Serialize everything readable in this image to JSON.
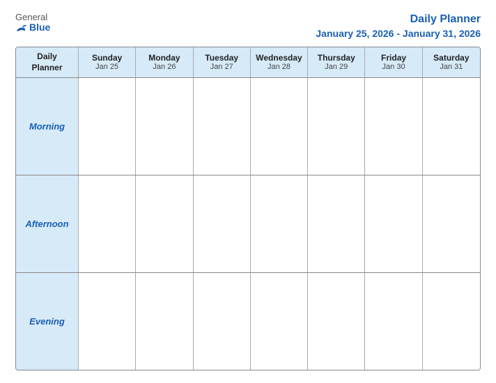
{
  "header": {
    "logo_general": "General",
    "logo_blue": "Blue",
    "title_line1": "Daily Planner",
    "title_line2": "January 25, 2026 - January 31, 2026"
  },
  "calendar": {
    "header": {
      "col0_line1": "Daily",
      "col0_line2": "Planner",
      "days": [
        {
          "name": "Sunday",
          "date": "Jan 25"
        },
        {
          "name": "Monday",
          "date": "Jan 26"
        },
        {
          "name": "Tuesday",
          "date": "Jan 27"
        },
        {
          "name": "Wednesday",
          "date": "Jan 28"
        },
        {
          "name": "Thursday",
          "date": "Jan 29"
        },
        {
          "name": "Friday",
          "date": "Jan 30"
        },
        {
          "name": "Saturday",
          "date": "Jan 31"
        }
      ]
    },
    "rows": [
      {
        "label": "Morning"
      },
      {
        "label": "Afternoon"
      },
      {
        "label": "Evening"
      }
    ]
  }
}
